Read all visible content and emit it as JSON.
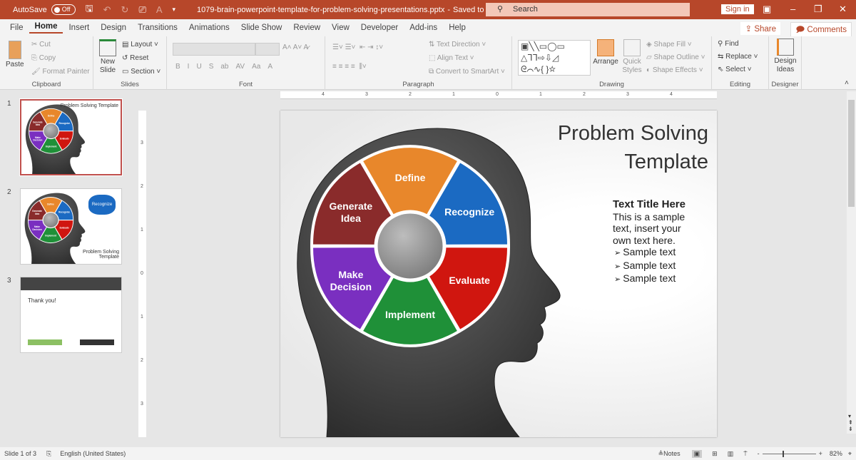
{
  "titlebar": {
    "autosave_label": "AutoSave",
    "autosave_state": "Off",
    "filename": "1079-brain-powerpoint-template-for-problem-solving-presentations.pptx",
    "save_status": "Saved to this PC",
    "search_placeholder": "Search",
    "signin": "Sign in"
  },
  "menu": {
    "tabs": [
      "File",
      "Home",
      "Insert",
      "Design",
      "Transitions",
      "Animations",
      "Slide Show",
      "Review",
      "View",
      "Developer",
      "Add-ins",
      "Help"
    ],
    "active": "Home",
    "share": "Share",
    "comments": "Comments"
  },
  "ribbon": {
    "clipboard": {
      "label": "Clipboard",
      "paste": "Paste",
      "cut": "Cut",
      "copy": "Copy",
      "format_painter": "Format Painter"
    },
    "slides": {
      "label": "Slides",
      "new_slide": "New Slide",
      "layout": "Layout",
      "reset": "Reset",
      "section": "Section"
    },
    "font": {
      "label": "Font",
      "buttons": [
        "B",
        "I",
        "U",
        "S",
        "ab",
        "AV",
        "Aa",
        "A"
      ]
    },
    "paragraph": {
      "label": "Paragraph",
      "text_direction": "Text Direction",
      "align_text": "Align Text",
      "convert_smartart": "Convert to SmartArt"
    },
    "drawing": {
      "label": "Drawing",
      "arrange": "Arrange",
      "quick_styles": "Quick Styles",
      "shape_fill": "Shape Fill",
      "shape_outline": "Shape Outline",
      "shape_effects": "Shape Effects"
    },
    "editing": {
      "label": "Editing",
      "find": "Find",
      "replace": "Replace",
      "select": "Select"
    },
    "designer": {
      "label": "Designer",
      "design_ideas": "Design Ideas"
    }
  },
  "thumbnails": [
    {
      "num": "1",
      "title": "Problem Solving Template"
    },
    {
      "num": "2",
      "title": "Problem Solving Template",
      "badge": "Recognize"
    },
    {
      "num": "3",
      "title": "Thank you!"
    }
  ],
  "ruler": {
    "h": [
      "4",
      "3",
      "2",
      "1",
      "0",
      "1",
      "2",
      "3",
      "4"
    ],
    "v": [
      "3",
      "2",
      "1",
      "0",
      "1",
      "2",
      "3"
    ]
  },
  "slide": {
    "title_line1": "Problem Solving",
    "title_line2": "Template",
    "body_heading": "Text Title Here",
    "body_text": "This is a sample text, insert your own text here.",
    "bullets": [
      "Sample text",
      "Sample text",
      "Sample text"
    ],
    "petals": [
      {
        "label": "Define",
        "color": "#e8872b"
      },
      {
        "label": "Recognize",
        "color": "#1b6ac2"
      },
      {
        "label": "Evaluate",
        "color": "#d0160f"
      },
      {
        "label": "Implement",
        "color": "#1f9038"
      },
      {
        "label": "Make Decision",
        "color": "#7a2fc0"
      },
      {
        "label": "Generate Idea",
        "color": "#8a2b2b"
      }
    ]
  },
  "status": {
    "slide": "Slide 1 of 3",
    "language": "English (United States)",
    "notes": "Notes",
    "zoom": "82%"
  }
}
